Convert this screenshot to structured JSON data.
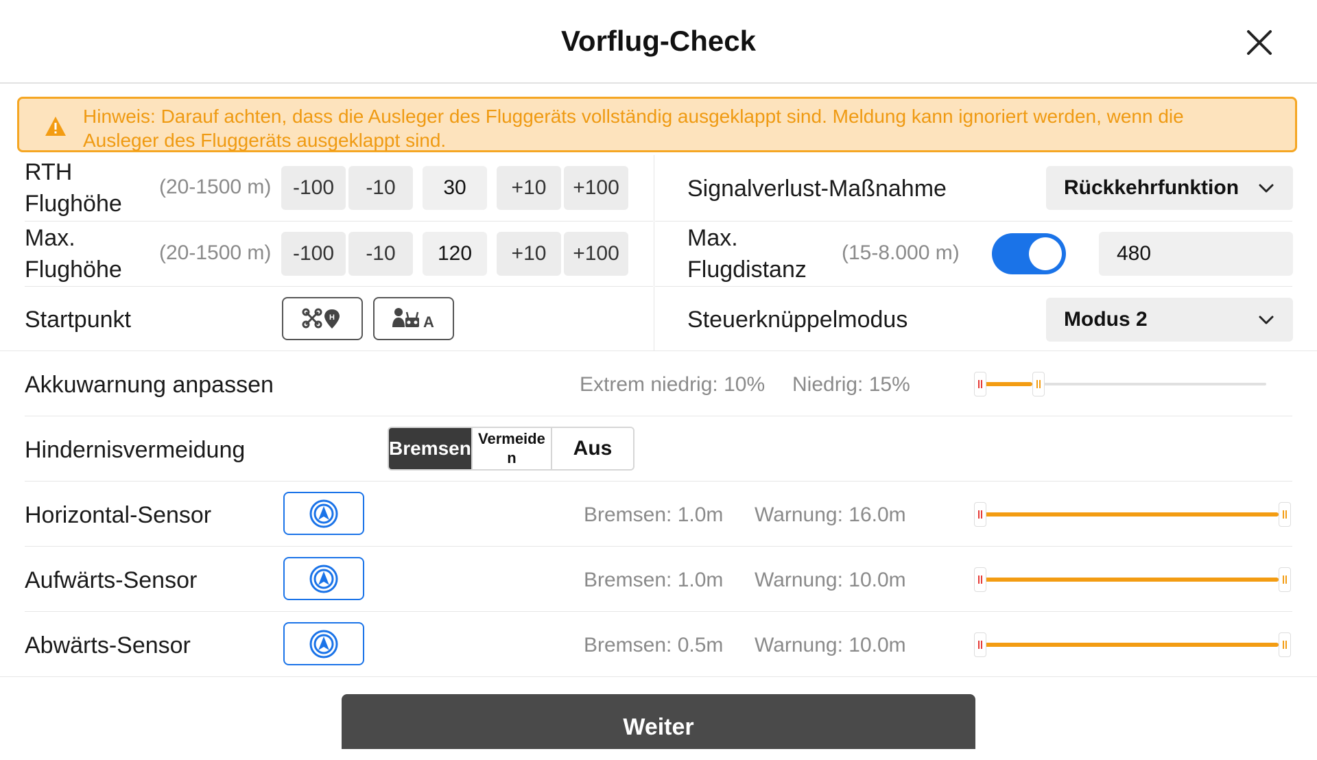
{
  "header": {
    "title": "Vorflug-Check"
  },
  "notice": {
    "text": "Hinweis: Darauf achten, dass die Ausleger des Fluggeräts vollständig ausgeklappt sind. Meldung kann ignoriert werden, wenn die Ausleger des Fluggeräts ausgeklappt sind."
  },
  "rth": {
    "label_line1": "RTH",
    "label_line2": "Flughöhe",
    "range": "(20-1500 m)",
    "minus100": "-100",
    "minus10": "-10",
    "value": "30",
    "plus10": "+10",
    "plus100": "+100"
  },
  "max_height": {
    "label_line1": "Max.",
    "label_line2": "Flughöhe",
    "range": "(20-1500 m)",
    "minus100": "-100",
    "minus10": "-10",
    "value": "120",
    "plus10": "+10",
    "plus100": "+100"
  },
  "signal_loss": {
    "label": "Signalverlust-Maßnahme",
    "selected": "Rückkehrfunktion"
  },
  "max_distance": {
    "label_line1": "Max.",
    "label_line2": "Flugdistanz",
    "range": "(15-8.000 m)",
    "enabled": true,
    "value": "480"
  },
  "startpoint": {
    "label": "Startpunkt"
  },
  "stick_mode": {
    "label": "Steuerknüppelmodus",
    "selected": "Modus 2"
  },
  "battery": {
    "label": "Akkuwarnung anpassen",
    "critical_text": "Extrem niedrig: 10%",
    "low_text": "Niedrig: 15%",
    "critical_percent": 10,
    "low_percent": 15
  },
  "obstacle": {
    "label": "Hindernisvermeidung",
    "options": [
      "Bremsen",
      "Vermeiden",
      "Aus"
    ],
    "option_vermeiden_display": "Vermeide n",
    "selected": "Bremsen"
  },
  "sensors": [
    {
      "label": "Horizontal-Sensor",
      "brake_text": "Bremsen: 1.0m",
      "warn_text": "Warnung: 16.0m",
      "brake_m": 1.0,
      "warn_m": 16.0
    },
    {
      "label": "Aufwärts-Sensor",
      "brake_text": "Bremsen: 1.0m",
      "warn_text": "Warnung: 10.0m",
      "brake_m": 1.0,
      "warn_m": 10.0
    },
    {
      "label": "Abwärts-Sensor",
      "brake_text": "Bremsen: 0.5m",
      "warn_text": "Warnung: 10.0m",
      "brake_m": 0.5,
      "warn_m": 10.0
    }
  ],
  "footer": {
    "next_label": "Weiter"
  },
  "colors": {
    "accent_blue": "#1a73e8",
    "warning_orange": "#f39c12",
    "notice_bg": "#fde3bd",
    "dark_button": "#4a4a4a"
  },
  "icons": [
    "close-icon",
    "warning-triangle-icon",
    "chevron-down-icon",
    "drone-home-point-icon",
    "pilot-home-point-icon",
    "obstacle-sensor-icon"
  ]
}
